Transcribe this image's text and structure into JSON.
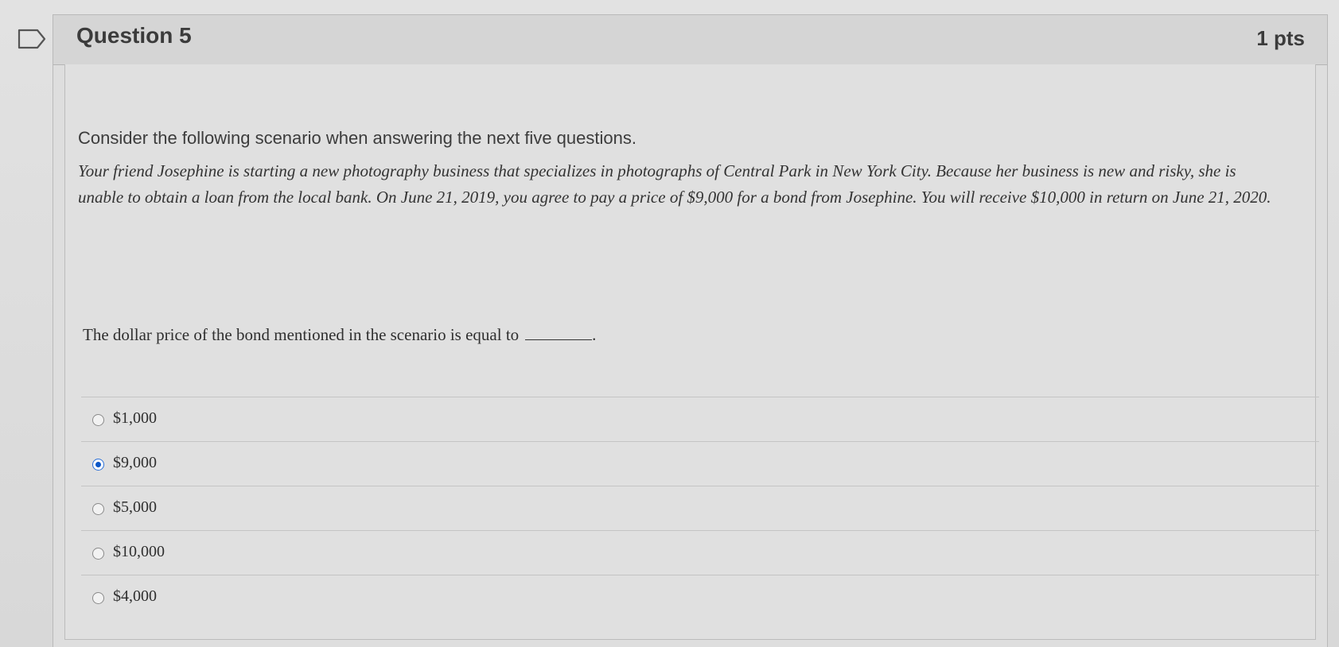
{
  "question": {
    "title": "Question 5",
    "points": "1 pts",
    "intro": "Consider the following scenario when answering the next five questions.",
    "scenario": "Your friend Josephine is starting a new photography business that specializes in photographs of Central Park in New York City. Because her business is new and risky, she is unable to obtain a loan from the local bank. On June 21, 2019, you agree to pay a price of $9,000 for a bond from Josephine. You will receive $10,000 in return on June 21, 2020.",
    "prompt": "The dollar price of the bond mentioned in the scenario is equal to",
    "prompt_end": ".",
    "answers": [
      {
        "label": "$1,000",
        "selected": false
      },
      {
        "label": "$9,000",
        "selected": true
      },
      {
        "label": "$5,000",
        "selected": false
      },
      {
        "label": "$10,000",
        "selected": false
      },
      {
        "label": "$4,000",
        "selected": false
      }
    ]
  },
  "icons": {
    "flag": "flag-icon",
    "radio": "radio-button-icon"
  },
  "colors": {
    "selected_radio": "#0b57c7",
    "header_bg": "#d5d5d5",
    "text": "#3b3b3b"
  }
}
